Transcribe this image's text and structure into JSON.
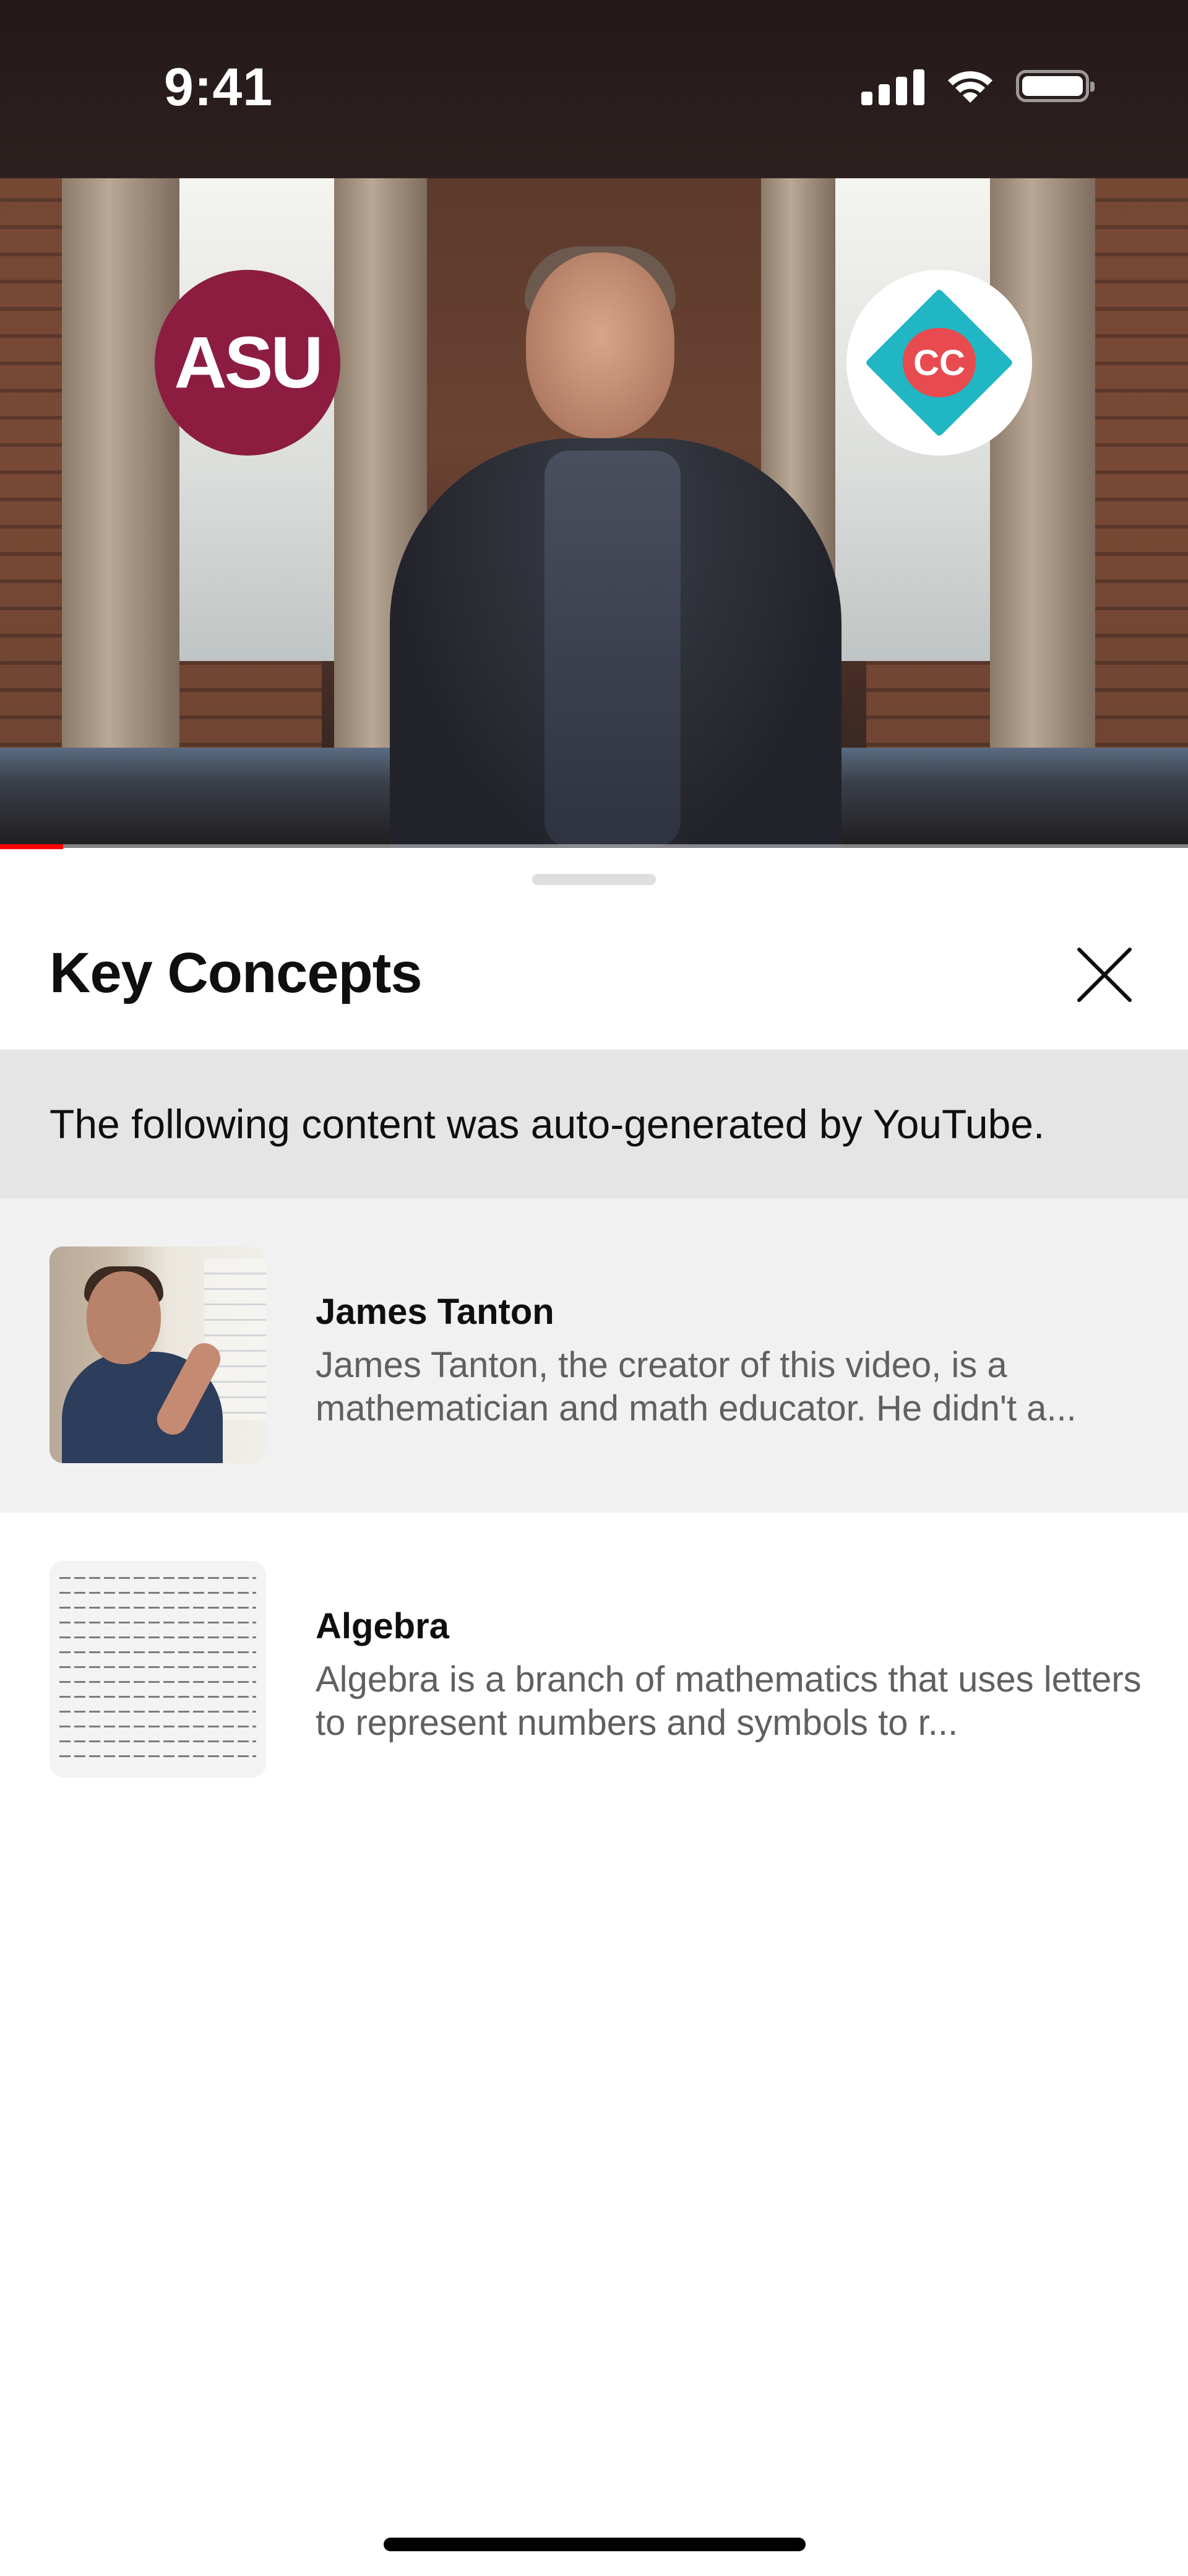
{
  "status_bar": {
    "time": "9:41",
    "icons": [
      "signal-icon",
      "wifi-icon",
      "battery-icon"
    ]
  },
  "video": {
    "progress": 0.053,
    "progress_color": "#ff0000",
    "logos": [
      {
        "name": "asu-logo",
        "text": "ASU",
        "color": "#8c1d40"
      },
      {
        "name": "crashcourse-logo",
        "text": "CC",
        "color": "#21b6c4"
      }
    ]
  },
  "sheet": {
    "title": "Key Concepts",
    "close_icon": "close-icon",
    "notice": "The following content was auto-generated by YouTube."
  },
  "concepts": [
    {
      "name": "James Tanton",
      "description": "James Tanton, the creator of this video, is a mathematician and math educator. He didn't a...",
      "thumbnail": "person-photo"
    },
    {
      "name": "Algebra",
      "description": "Algebra is a branch of mathematics that uses letters to represent numbers and symbols to r...",
      "thumbnail": "formula-image"
    }
  ]
}
